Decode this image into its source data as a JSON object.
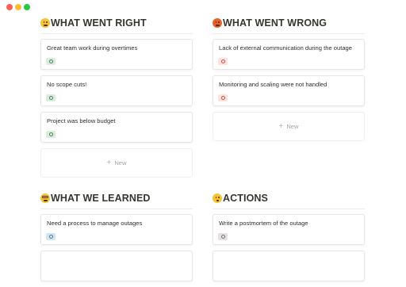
{
  "sections": [
    {
      "title": "WHAT WENT RIGHT",
      "emoji": "slightly-smiling-face-icon",
      "cards": [
        {
          "title": "Great team work during overtimes",
          "badge_color": "#dbeddb"
        },
        {
          "title": "No scope cuts!",
          "badge_color": "#dbeddb"
        },
        {
          "title": "Project was below budget",
          "badge_color": "#dbeddb"
        }
      ],
      "new_label": "New"
    },
    {
      "title": "WHAT WENT WRONG",
      "emoji": "angry-face-icon",
      "cards": [
        {
          "title": "Lack of external communication during the outage",
          "badge_color": "#ffe2dd"
        },
        {
          "title": "Monitoring and scaling were not handled",
          "badge_color": "#ffe2dd"
        }
      ],
      "new_label": "New"
    },
    {
      "title": "WHAT WE LEARNED",
      "emoji": "nerd-face-icon",
      "cards": [
        {
          "title": "Need a process to manage outages",
          "badge_color": "#d3e5ef"
        }
      ]
    },
    {
      "title": "ACTIONS",
      "emoji": "thinking-face-icon",
      "cards": [
        {
          "title": "Write a postmortem of the outage",
          "badge_color": "#e3e2e0"
        }
      ]
    }
  ]
}
